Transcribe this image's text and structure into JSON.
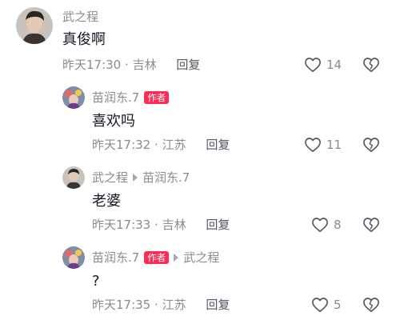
{
  "comments": [
    {
      "username": "武之程",
      "content": "真俊啊",
      "time": "昨天17:30",
      "location": "吉林",
      "reply_label": "回复",
      "likes": "14"
    },
    {
      "username": "苗润东.7",
      "badge": "作者",
      "content": "喜欢吗",
      "time": "昨天17:32",
      "location": "江苏",
      "reply_label": "回复",
      "likes": "11"
    },
    {
      "username": "武之程",
      "reply_to": "苗润东.7",
      "content": "老婆",
      "time": "昨天17:33",
      "location": "吉林",
      "reply_label": "回复",
      "likes": "8"
    },
    {
      "username": "苗润东.7",
      "badge": "作者",
      "reply_to": "武之程",
      "content": "?",
      "time": "昨天17:35",
      "location": "江苏",
      "reply_label": "回复",
      "likes": "5"
    }
  ],
  "icons": {
    "like": "heart-outline-icon",
    "dislike": "broken-heart-icon"
  },
  "colors": {
    "author_badge": "#fe2c55",
    "meta_text": "#8a8b91",
    "content_text": "#161823"
  }
}
